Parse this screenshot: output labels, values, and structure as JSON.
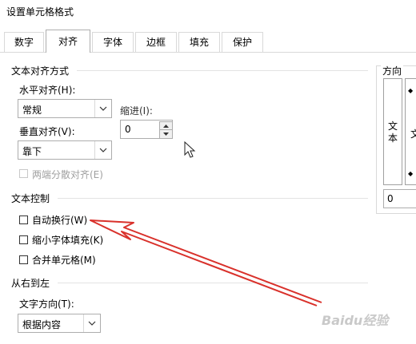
{
  "dialog": {
    "title": "设置单元格格式"
  },
  "tabs": [
    {
      "label": "数字"
    },
    {
      "label": "对齐"
    },
    {
      "label": "字体"
    },
    {
      "label": "边框"
    },
    {
      "label": "填充"
    },
    {
      "label": "保护"
    }
  ],
  "active_tab": "对齐",
  "text_alignment": {
    "section_title": "文本对齐方式",
    "horizontal": {
      "label": "水平对齐(H):",
      "value": "常规"
    },
    "indent": {
      "label": "缩进(I):",
      "value": "0"
    },
    "vertical": {
      "label": "垂直对齐(V):",
      "value": "靠下"
    },
    "justify_distributed": {
      "label": "两端分散对齐(E)",
      "checked": false,
      "disabled": true
    }
  },
  "text_control": {
    "section_title": "文本控制",
    "wrap_text": {
      "label": "自动换行(W)",
      "checked": false
    },
    "shrink_to_fit": {
      "label": "缩小字体填充(K)",
      "checked": false
    },
    "merge_cells": {
      "label": "合并单元格(M)",
      "checked": false
    }
  },
  "rtl": {
    "section_title": "从右到左",
    "direction": {
      "label": "文字方向(T):",
      "value": "根据内容"
    }
  },
  "orientation": {
    "section_title": "方向",
    "vertical_text": "文本",
    "angle_text": "文",
    "degrees_value": "0"
  },
  "annotation": {
    "arrow_color": "#d9312b"
  },
  "watermark": {
    "text": "Baidu经验"
  },
  "colors": {
    "border": "#adadad",
    "separator": "#e3e3e3"
  }
}
